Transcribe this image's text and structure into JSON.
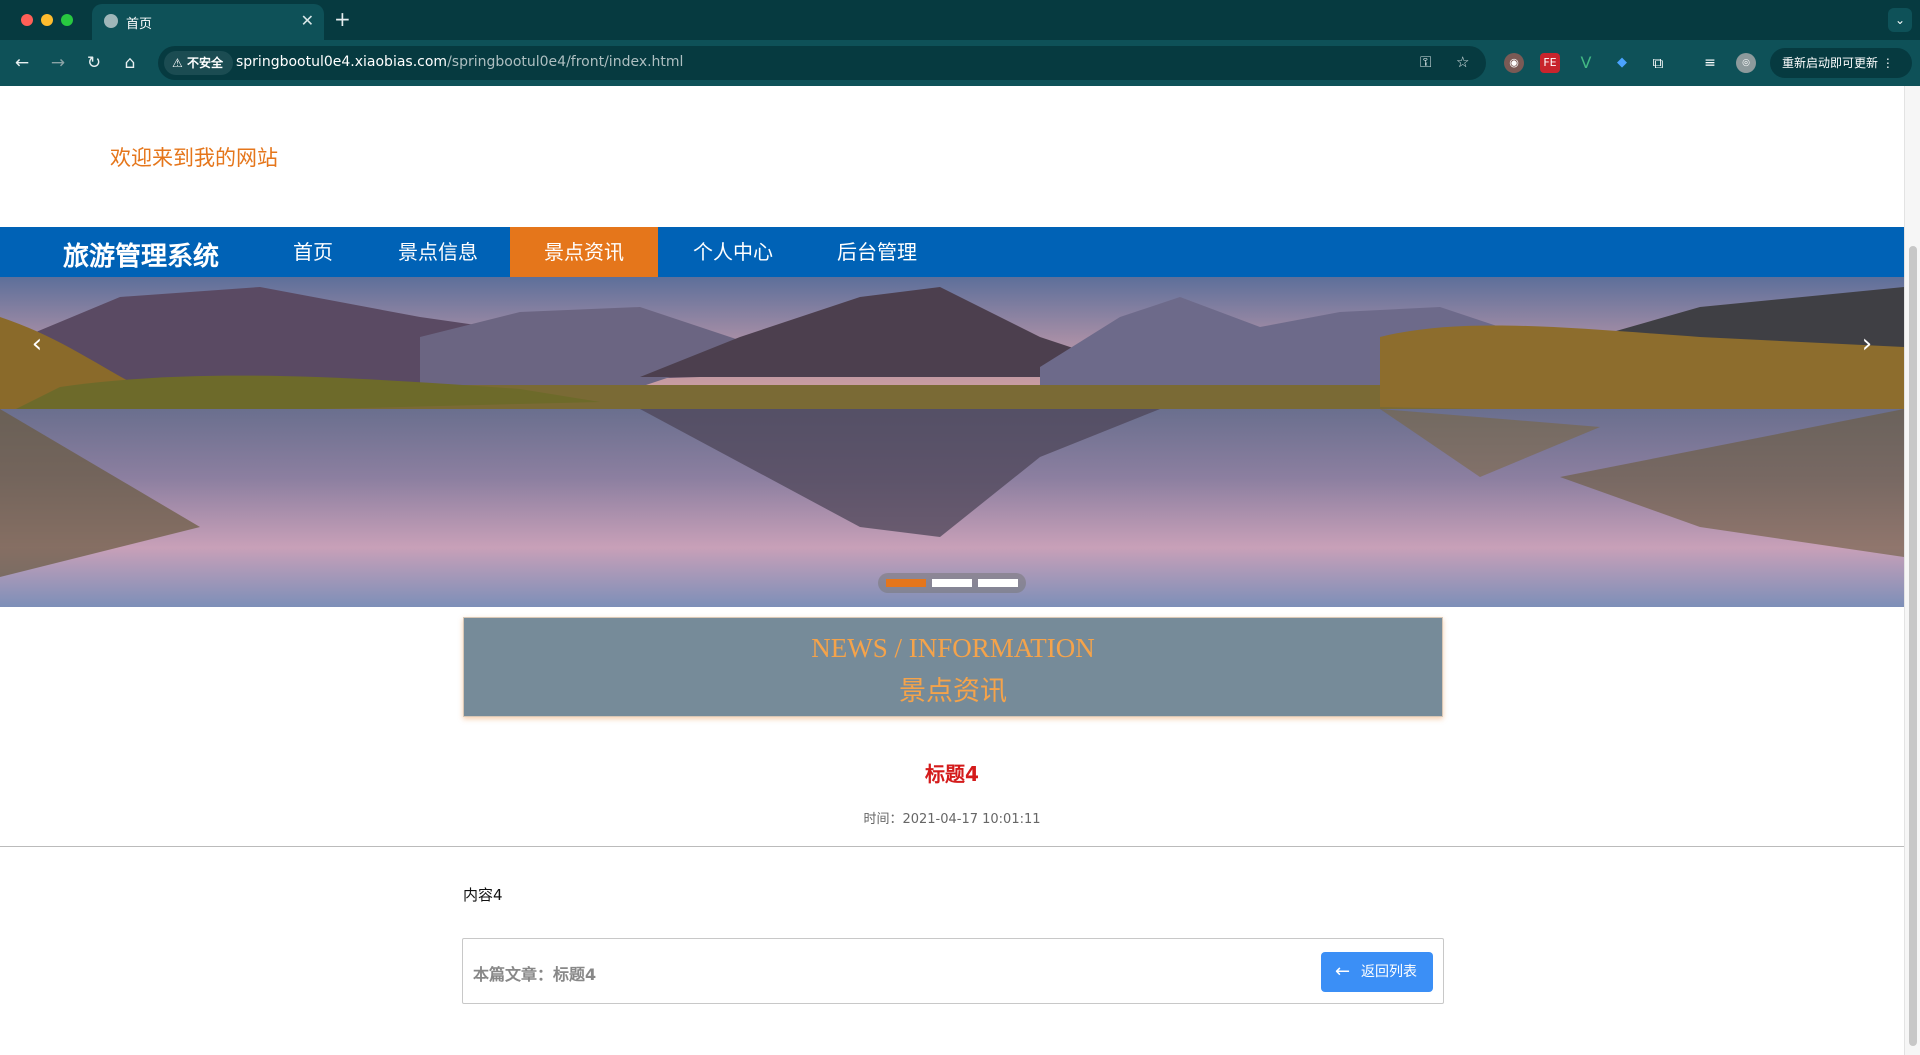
{
  "browser": {
    "tab_title": "首页",
    "new_tab": "+",
    "insecure_label": "不安全",
    "url_host": "springbootul0e4.xiaobias.com",
    "url_path": "/springbootul0e4/front/index.html",
    "update_label": "重新启动即可更新"
  },
  "site": {
    "welcome": "欢迎来到我的网站",
    "brand": "旅游管理系统",
    "nav": [
      "首页",
      "景点信息",
      "景点资讯",
      "个人中心",
      "后台管理"
    ],
    "active_nav": "景点资讯",
    "accent_color": "#e5761b",
    "nav_color": "#0062b6"
  },
  "carousel": {
    "slides": 3,
    "active_slide": 1
  },
  "section": {
    "title_en": "NEWS / INFORMATION",
    "title_cn": "景点资讯"
  },
  "article": {
    "title": "标题4",
    "time": "时间：2021-04-17 10:01:11",
    "content": "内容4",
    "current_label": "本篇文章：标题4",
    "back_button": "返回列表"
  }
}
